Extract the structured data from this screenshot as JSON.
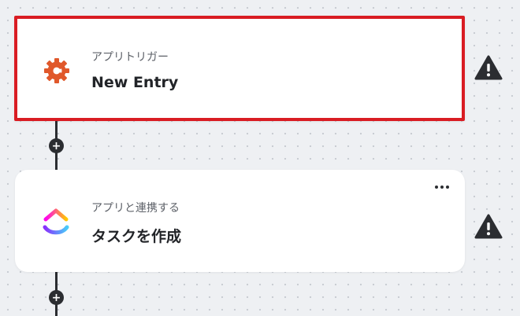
{
  "steps": [
    {
      "subtitle": "アプリトリガー",
      "title": "New Entry",
      "icon": "cognito-forms-gear-icon",
      "selected": true,
      "status": "warning"
    },
    {
      "subtitle": "アプリと連携する",
      "title": "タスクを作成",
      "icon": "clickup-logo-icon",
      "selected": false,
      "status": "warning"
    }
  ],
  "colors": {
    "selection_border": "#d91c23",
    "trigger_icon": "#e0582b",
    "connector": "#2b2d31",
    "warning": "#2b2d31"
  }
}
